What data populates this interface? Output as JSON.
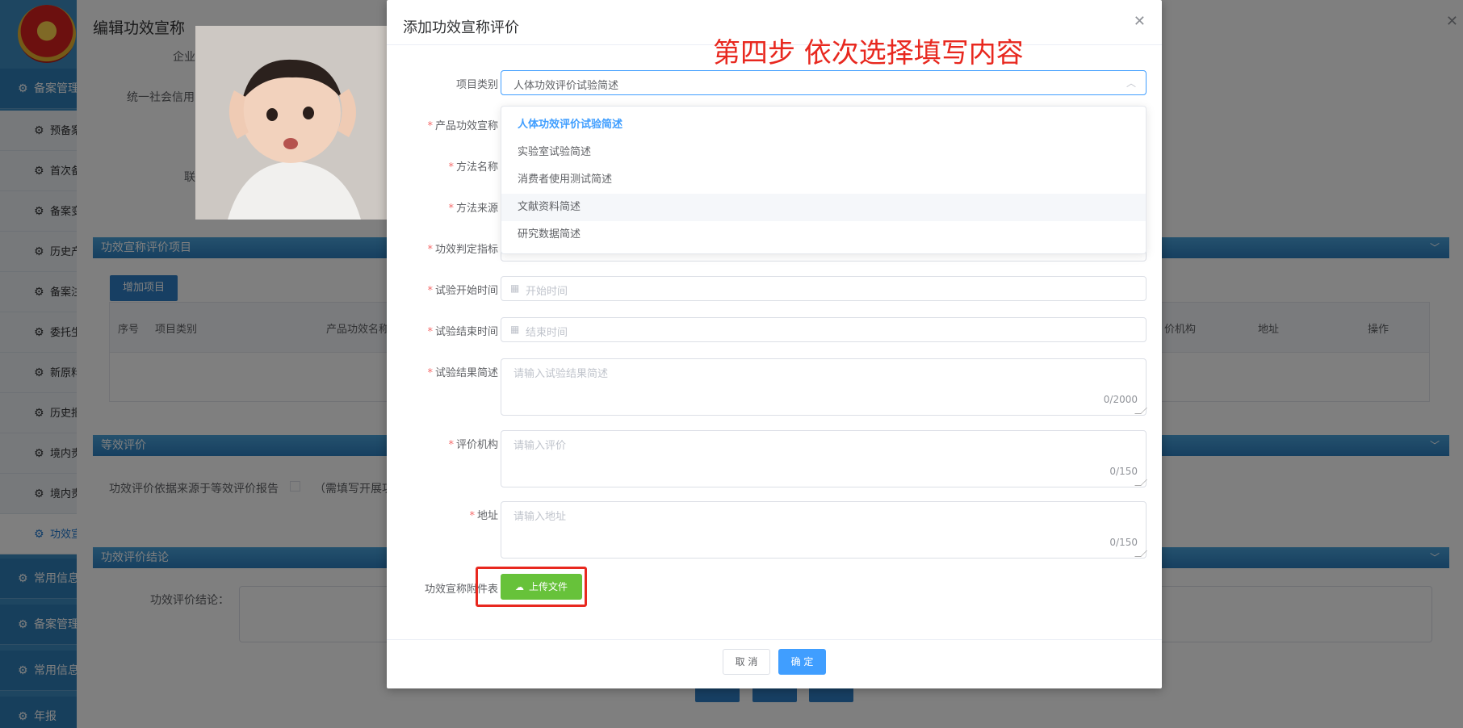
{
  "sidebar": {
    "items": [
      {
        "label": "备案管理",
        "type": "group"
      },
      {
        "label": "预备案",
        "type": "sub"
      },
      {
        "label": "首次备案",
        "type": "sub"
      },
      {
        "label": "备案变更",
        "type": "sub"
      },
      {
        "label": "历史产品",
        "type": "sub"
      },
      {
        "label": "备案注销",
        "type": "sub"
      },
      {
        "label": "委托生产",
        "type": "sub"
      },
      {
        "label": "新原料",
        "type": "sub"
      },
      {
        "label": "历史报告",
        "type": "sub"
      },
      {
        "label": "境内责任人",
        "type": "sub"
      },
      {
        "label": "境内责任人",
        "type": "sub"
      },
      {
        "label": "功效宣称",
        "type": "sub",
        "active": true
      },
      {
        "label": "常用信息",
        "type": "group"
      },
      {
        "label": "备案管理",
        "type": "group"
      },
      {
        "label": "常用信息",
        "type": "group"
      },
      {
        "label": "年报",
        "type": "group"
      }
    ]
  },
  "background": {
    "title": "编辑功效宣称",
    "labels": {
      "company": "企业",
      "credit_code": "统一社会信用",
      "contact": "联"
    },
    "section_claim": "功效宣称评价项目",
    "add_item_button": "增加项目",
    "table_headers": [
      "序号",
      "项目类别",
      "产品功效名称",
      "价机构",
      "地址",
      "操作"
    ],
    "section_equivalent": "等效评价",
    "equivalent_text": "功效评价依据来源于等效评价报告",
    "equivalent_note": "（需填写开展功",
    "section_conclusion": "功效评价结论",
    "conclusion_label": "功效评价结论："
  },
  "dialog": {
    "title": "添加功效宣称评价",
    "annotation": "第四步   依次选择填写内容",
    "fields": {
      "category": {
        "label": "项目类别",
        "value": "人体功效评价试验简述"
      },
      "claim": {
        "label": "产品功效宣称"
      },
      "method_name": {
        "label": "方法名称"
      },
      "method_source": {
        "label": "方法来源"
      },
      "indicator": {
        "label": "功效判定指标"
      },
      "start_time": {
        "label": "试验开始时间",
        "placeholder": "开始时间"
      },
      "end_time": {
        "label": "试验结束时间",
        "placeholder": "结束时间"
      },
      "result": {
        "label": "试验结果简述",
        "placeholder": "请输入试验结果简述",
        "count": "0/2000"
      },
      "org": {
        "label": "评价机构",
        "placeholder": "请输入评价",
        "count": "0/150"
      },
      "address": {
        "label": "地址",
        "placeholder": "请输入地址",
        "count": "0/150"
      },
      "attachment": {
        "label": "功效宣称附件表"
      }
    },
    "category_options": [
      {
        "label": "人体功效评价试验简述",
        "selected": true
      },
      {
        "label": "实验室试验简述"
      },
      {
        "label": "消费者使用测试简述"
      },
      {
        "label": "文献资料简述",
        "hover": true
      },
      {
        "label": "研究数据简述"
      }
    ],
    "upload_label": "上传文件",
    "cancel_label": "取 消",
    "ok_label": "确 定"
  },
  "colors": {
    "primary": "#409eff",
    "required": "#f56c6c",
    "upload": "#67c23a",
    "annotation": "#e8281f",
    "sidebar": "#3d8dc3"
  }
}
